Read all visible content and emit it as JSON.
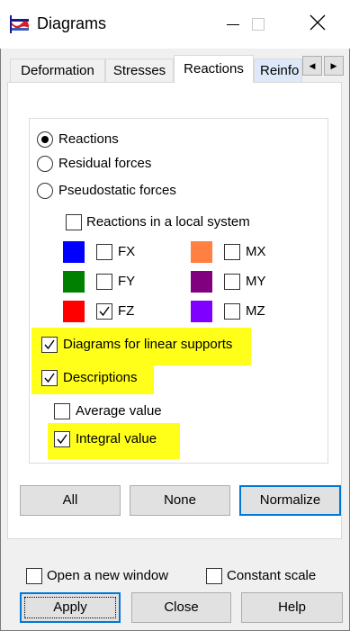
{
  "window": {
    "title": "Diagrams",
    "close_glyph": "✕"
  },
  "tabs": [
    "Deformation",
    "Stresses",
    "Reactions",
    "Reinfo"
  ],
  "tab_scroll": {
    "left": "◀",
    "right": "▶"
  },
  "display_options": {
    "selected": "Reactions",
    "radios": [
      "Reactions",
      "Residual forces",
      "Pseudostatic forces"
    ]
  },
  "local_system": {
    "label": "Reactions in a local system",
    "checked": false
  },
  "components": [
    {
      "label": "FX",
      "color": "#0000ff",
      "checked": false
    },
    {
      "label": "FY",
      "color": "#008000",
      "checked": false
    },
    {
      "label": "FZ",
      "color": "#ff0000",
      "checked": true
    },
    {
      "label": "MX",
      "color": "#ff8040",
      "checked": false
    },
    {
      "label": "MY",
      "color": "#800080",
      "checked": false
    },
    {
      "label": "MZ",
      "color": "#8000ff",
      "checked": false
    }
  ],
  "options": {
    "diagrams_linear_supports": {
      "label": "Diagrams for linear supports",
      "checked": true
    },
    "descriptions": {
      "label": "Descriptions",
      "checked": true
    },
    "average_value": {
      "label": "Average value",
      "checked": false
    },
    "integral_value": {
      "label": "Integral value",
      "checked": true
    }
  },
  "highlight_color": "#ffff1a",
  "buttons": {
    "all": "All",
    "none": "None",
    "normalize": "Normalize"
  },
  "footer": {
    "open_new_window": {
      "label": "Open a new window",
      "checked": false
    },
    "constant_scale": {
      "label": "Constant scale",
      "checked": false
    },
    "apply": "Apply",
    "close": "Close",
    "help": "Help"
  }
}
